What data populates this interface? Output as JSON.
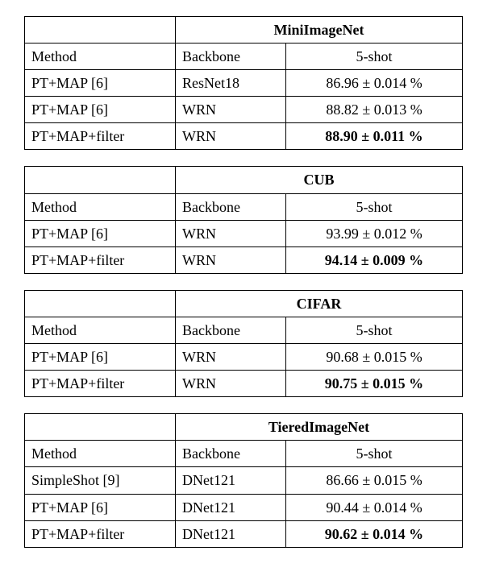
{
  "columns": {
    "method": "Method",
    "backbone": "Backbone",
    "shot": "5-shot"
  },
  "tables": [
    {
      "title": "MiniImageNet",
      "rows": [
        {
          "method": "PT+MAP [6]",
          "backbone": "ResNet18",
          "val": "86.96 ± 0.014 %",
          "bold": false
        },
        {
          "method": "PT+MAP [6]",
          "backbone": "WRN",
          "val": "88.82 ± 0.013 %",
          "bold": false
        }
      ],
      "last": {
        "method": "PT+MAP+filter",
        "backbone": "WRN",
        "val": "88.90 ± 0.011 %",
        "bold": true
      }
    },
    {
      "title": "CUB",
      "rows": [
        {
          "method": "PT+MAP [6]",
          "backbone": "WRN",
          "val": "93.99 ± 0.012 %",
          "bold": false
        }
      ],
      "last": {
        "method": "PT+MAP+filter",
        "backbone": "WRN",
        "val": "94.14 ± 0.009 %",
        "bold": true
      }
    },
    {
      "title": "CIFAR",
      "rows": [
        {
          "method": "PT+MAP [6]",
          "backbone": "WRN",
          "val": "90.68 ± 0.015 %",
          "bold": false
        }
      ],
      "last": {
        "method": "PT+MAP+filter",
        "backbone": "WRN",
        "val": "90.75 ± 0.015 %",
        "bold": true
      }
    },
    {
      "title": "TieredImageNet",
      "rows": [
        {
          "method": "SimpleShot [9]",
          "backbone": "DNet121",
          "val": "86.66 ± 0.015 %",
          "bold": false
        },
        {
          "method": "PT+MAP [6]",
          "backbone": "DNet121",
          "val": "90.44 ± 0.014 %",
          "bold": false
        }
      ],
      "last": {
        "method": "PT+MAP+filter",
        "backbone": "DNet121",
        "val": "90.62 ± 0.014 %",
        "bold": true
      }
    }
  ],
  "chart_data": [
    {
      "type": "table",
      "title": "MiniImageNet",
      "columns": [
        "Method",
        "Backbone",
        "5-shot"
      ],
      "rows": [
        [
          "PT+MAP [6]",
          "ResNet18",
          "86.96 ± 0.014 %"
        ],
        [
          "PT+MAP [6]",
          "WRN",
          "88.82 ± 0.013 %"
        ],
        [
          "PT+MAP+filter",
          "WRN",
          "88.90 ± 0.011 %"
        ]
      ]
    },
    {
      "type": "table",
      "title": "CUB",
      "columns": [
        "Method",
        "Backbone",
        "5-shot"
      ],
      "rows": [
        [
          "PT+MAP [6]",
          "WRN",
          "93.99 ± 0.012 %"
        ],
        [
          "PT+MAP+filter",
          "WRN",
          "94.14 ± 0.009 %"
        ]
      ]
    },
    {
      "type": "table",
      "title": "CIFAR",
      "columns": [
        "Method",
        "Backbone",
        "5-shot"
      ],
      "rows": [
        [
          "PT+MAP [6]",
          "WRN",
          "90.68 ± 0.015 %"
        ],
        [
          "PT+MAP+filter",
          "WRN",
          "90.75 ± 0.015 %"
        ]
      ]
    },
    {
      "type": "table",
      "title": "TieredImageNet",
      "columns": [
        "Method",
        "Backbone",
        "5-shot"
      ],
      "rows": [
        [
          "SimpleShot [9]",
          "DNet121",
          "86.66 ± 0.015 %"
        ],
        [
          "PT+MAP [6]",
          "DNet121",
          "90.44 ± 0.014 %"
        ],
        [
          "PT+MAP+filter",
          "DNet121",
          "90.62 ± 0.014 %"
        ]
      ]
    }
  ]
}
